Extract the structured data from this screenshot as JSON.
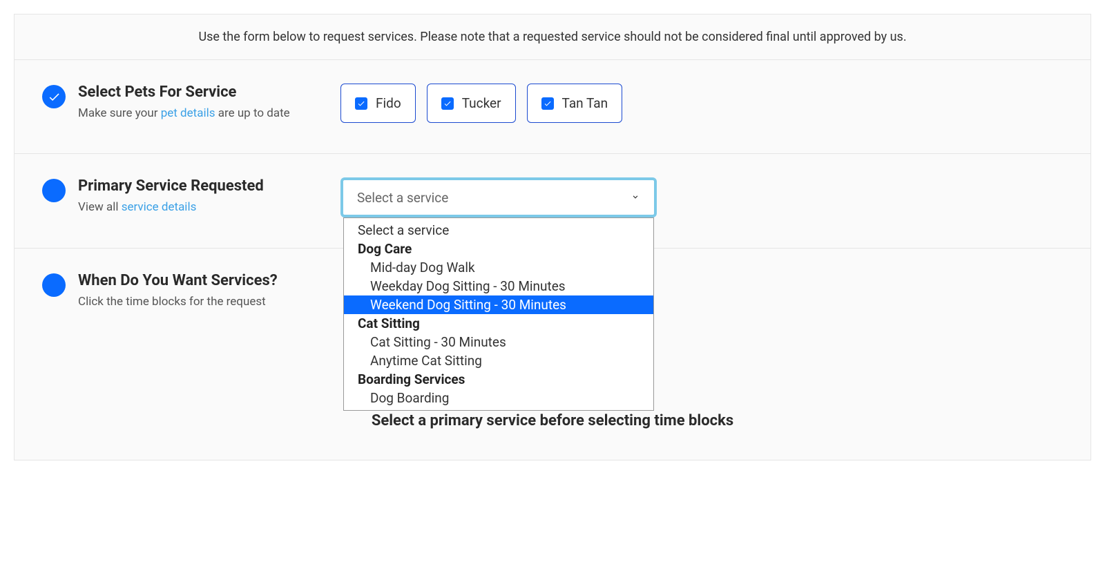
{
  "intro": "Use the form below to request services. Please note that a requested service should not be considered final until approved by us.",
  "step1": {
    "title": "Select Pets For Service",
    "subtitle_before": "Make sure your ",
    "subtitle_link": "pet details",
    "subtitle_after": " are up to date",
    "completed": true,
    "pets": [
      {
        "name": "Fido",
        "checked": true
      },
      {
        "name": "Tucker",
        "checked": true
      },
      {
        "name": "Tan Tan",
        "checked": true
      }
    ]
  },
  "step2": {
    "title": "Primary Service Requested",
    "subtitle_before": "View all ",
    "subtitle_link": "service details",
    "subtitle_after": "",
    "placeholder": "Select a service",
    "dropdown": {
      "first_option": "Select a service",
      "groups": [
        {
          "label": "Dog Care",
          "options": [
            "Mid-day Dog Walk",
            "Weekday Dog Sitting - 30 Minutes",
            "Weekend Dog Sitting - 30 Minutes"
          ]
        },
        {
          "label": "Cat Sitting",
          "options": [
            "Cat Sitting - 30 Minutes",
            "Anytime Cat Sitting"
          ]
        },
        {
          "label": "Boarding Services",
          "options": [
            "Dog Boarding"
          ]
        }
      ],
      "highlighted": "Weekend Dog Sitting - 30 Minutes"
    }
  },
  "step3": {
    "title": "When Do You Want Services?",
    "subtitle": "Click the time blocks for the request",
    "message": "Select a primary service before selecting time blocks"
  }
}
